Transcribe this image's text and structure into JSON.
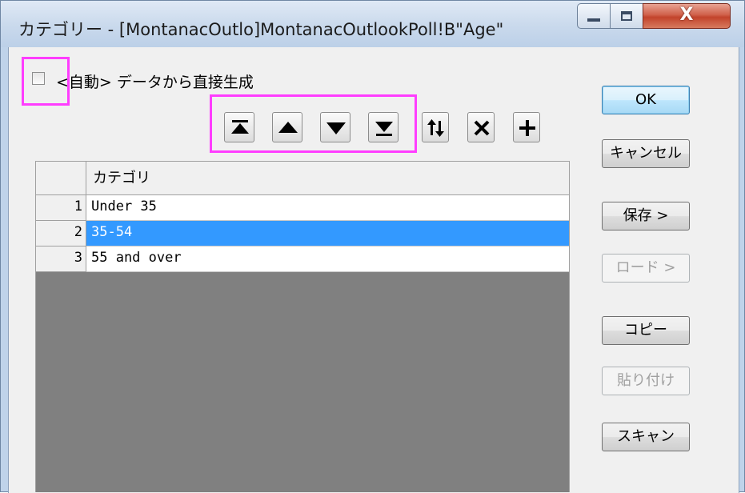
{
  "window": {
    "title": "カテゴリー - [MontanacOutlo]MontanacOutlookPoll!B\"Age\"",
    "close_glyph": "X"
  },
  "auto": {
    "label": "<自動> データから直接生成",
    "checked": false
  },
  "toolbar": {
    "icons": [
      "move-to-top-icon",
      "move-up-icon",
      "move-down-icon",
      "move-to-bottom-icon",
      "reverse-order-icon",
      "delete-icon",
      "add-icon"
    ]
  },
  "grid": {
    "column_header": "カテゴリ",
    "rows": [
      {
        "num": "1",
        "value": "Under 35",
        "selected": false
      },
      {
        "num": "2",
        "value": "35-54",
        "selected": true
      },
      {
        "num": "3",
        "value": "55 and over",
        "selected": false
      }
    ]
  },
  "buttons": {
    "ok": "OK",
    "cancel": "キャンセル",
    "save": "保存 >",
    "load": "ロード >",
    "copy": "コピー",
    "paste": "貼り付け",
    "scan": "スキャン"
  },
  "colors": {
    "highlight": "#ff3dff",
    "selection": "#3399ff"
  }
}
